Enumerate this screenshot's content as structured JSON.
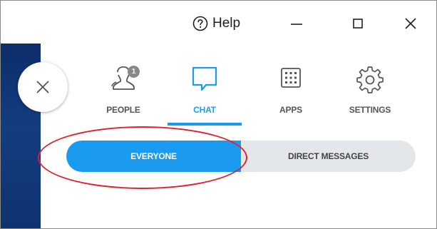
{
  "titlebar": {
    "help_label": "Help",
    "help_icon": "question-circle-icon",
    "minimize_icon": "minimize-icon",
    "maximize_icon": "maximize-icon",
    "close_icon": "close-icon"
  },
  "panel": {
    "close_icon": "close-icon"
  },
  "nav": {
    "tabs": [
      {
        "label": "PEOPLE",
        "icon": "people-icon",
        "badge": "1",
        "active": false
      },
      {
        "label": "CHAT",
        "icon": "chat-icon",
        "active": true
      },
      {
        "label": "APPS",
        "icon": "apps-grid-icon",
        "active": false
      },
      {
        "label": "SETTINGS",
        "icon": "gear-icon",
        "active": false
      }
    ]
  },
  "chat_filter": {
    "options": [
      {
        "label": "EVERYONE",
        "selected": true
      },
      {
        "label": "DIRECT MESSAGES",
        "selected": false
      }
    ]
  },
  "colors": {
    "accent": "#1a9bf0",
    "sidebar": "#133d80",
    "annotation": "#e0202a",
    "segment_bg": "#e4e7ea"
  }
}
